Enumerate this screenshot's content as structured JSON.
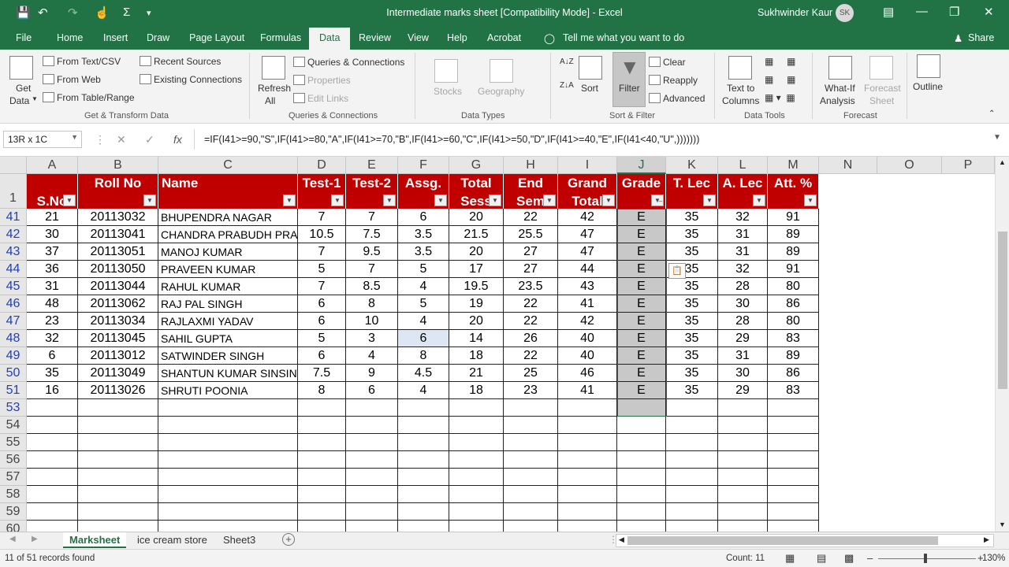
{
  "window": {
    "title": "Intermediate marks sheet  [Compatibility Mode]  -  Excel",
    "user": "Sukhwinder Kaur",
    "initials": "SK"
  },
  "menu": [
    "File",
    "Home",
    "Insert",
    "Draw",
    "Page Layout",
    "Formulas",
    "Data",
    "Review",
    "View",
    "Help",
    "Acrobat"
  ],
  "tell_me": "Tell me what you want to do",
  "share": "Share",
  "ribbon": {
    "get_data": "Get",
    "get_data2": "Data",
    "from_text": "From Text/CSV",
    "from_web": "From Web",
    "from_table": "From Table/Range",
    "recent_sources": "Recent Sources",
    "existing_connections": "Existing Connections",
    "group_get": "Get & Transform Data",
    "refresh": "Refresh",
    "refresh2": "All",
    "queries_connections": "Queries & Connections",
    "properties": "Properties",
    "edit_links": "Edit Links",
    "group_queries": "Queries & Connections",
    "stocks": "Stocks",
    "geography": "Geography",
    "group_types": "Data Types",
    "sort": "Sort",
    "filter": "Filter",
    "clear": "Clear",
    "reapply": "Reapply",
    "advanced": "Advanced",
    "group_sort": "Sort & Filter",
    "text_to_columns": "Text to",
    "text_to_columns2": "Columns",
    "group_tools": "Data Tools",
    "what_if": "What-If",
    "what_if2": "Analysis",
    "forecast_sheet": "Forecast",
    "forecast_sheet2": "Sheet",
    "group_forecast": "Forecast",
    "outline": "Outline"
  },
  "name_box": "13R x 1C",
  "formula": "=IF(I41>=90,\"S\",IF(I41>=80,\"A\",IF(I41>=70,\"B\",IF(I41>=60,\"C\",IF(I41>=50,\"D\",IF(I41>=40,\"E\",IF(I41<40,\"U\",)))))))",
  "columns": [
    "A",
    "B",
    "C",
    "D",
    "E",
    "F",
    "G",
    "H",
    "I",
    "J",
    "K",
    "L",
    "M",
    "N",
    "O",
    "P"
  ],
  "header_row": {
    "num": "1",
    "cells": [
      {
        "l1": "",
        "l2": "S.No"
      },
      {
        "l1": "Roll No",
        "l2": ""
      },
      {
        "l1": "Name",
        "l2": ""
      },
      {
        "l1": "Test-1",
        "l2": ""
      },
      {
        "l1": "Test-2",
        "l2": ""
      },
      {
        "l1": "Assg.",
        "l2": ""
      },
      {
        "l1": "Total",
        "l2": "Sess"
      },
      {
        "l1": "End",
        "l2": "Sem"
      },
      {
        "l1": "Grand",
        "l2": "Total"
      },
      {
        "l1": "Grade",
        "l2": ""
      },
      {
        "l1": "T. Lec",
        "l2": ""
      },
      {
        "l1": "A. Lec",
        "l2": ""
      },
      {
        "l1": "Att. %",
        "l2": ""
      }
    ]
  },
  "rows": [
    {
      "num": "41",
      "cells": [
        "21",
        "20113032",
        "BHUPENDRA NAGAR",
        "7",
        "7",
        "6",
        "20",
        "22",
        "42",
        "E",
        "35",
        "32",
        "91"
      ]
    },
    {
      "num": "42",
      "cells": [
        "30",
        "20113041",
        "CHANDRA PRABUDH PRAKASH",
        "10.5",
        "7.5",
        "3.5",
        "21.5",
        "25.5",
        "47",
        "E",
        "35",
        "31",
        "89"
      ]
    },
    {
      "num": "43",
      "cells": [
        "37",
        "20113051",
        "MANOJ KUMAR",
        "7",
        "9.5",
        "3.5",
        "20",
        "27",
        "47",
        "E",
        "35",
        "31",
        "89"
      ]
    },
    {
      "num": "44",
      "cells": [
        "36",
        "20113050",
        "PRAVEEN KUMAR",
        "5",
        "7",
        "5",
        "17",
        "27",
        "44",
        "E",
        "35",
        "32",
        "91"
      ]
    },
    {
      "num": "45",
      "cells": [
        "31",
        "20113044",
        "RAHUL KUMAR",
        "7",
        "8.5",
        "4",
        "19.5",
        "23.5",
        "43",
        "E",
        "35",
        "28",
        "80"
      ]
    },
    {
      "num": "46",
      "cells": [
        "48",
        "20113062",
        "RAJ PAL SINGH",
        "6",
        "8",
        "5",
        "19",
        "22",
        "41",
        "E",
        "35",
        "30",
        "86"
      ]
    },
    {
      "num": "47",
      "cells": [
        "23",
        "20113034",
        "RAJLAXMI YADAV",
        "6",
        "10",
        "4",
        "20",
        "22",
        "42",
        "E",
        "35",
        "28",
        "80"
      ]
    },
    {
      "num": "48",
      "cells": [
        "32",
        "20113045",
        "SAHIL GUPTA",
        "5",
        "3",
        "6",
        "14",
        "26",
        "40",
        "E",
        "35",
        "29",
        "83"
      ]
    },
    {
      "num": "49",
      "cells": [
        "6",
        "20113012",
        "SATWINDER SINGH",
        "6",
        "4",
        "8",
        "18",
        "22",
        "40",
        "E",
        "35",
        "31",
        "89"
      ]
    },
    {
      "num": "50",
      "cells": [
        "35",
        "20113049",
        "SHANTUN KUMAR SINSINWAR",
        "7.5",
        "9",
        "4.5",
        "21",
        "25",
        "46",
        "E",
        "35",
        "30",
        "86"
      ]
    },
    {
      "num": "51",
      "cells": [
        "16",
        "20113026",
        "SHRUTI POONIA",
        "8",
        "6",
        "4",
        "18",
        "23",
        "41",
        "E",
        "35",
        "29",
        "83"
      ]
    }
  ],
  "empty_rows": [
    "53",
    "54",
    "55",
    "56",
    "57",
    "58",
    "59",
    "60"
  ],
  "sheets": [
    "Marksheet",
    "ice cream store",
    "Sheet3"
  ],
  "status": {
    "records": "11 of 51 records found",
    "count": "Count: 11",
    "zoom": "130%"
  }
}
